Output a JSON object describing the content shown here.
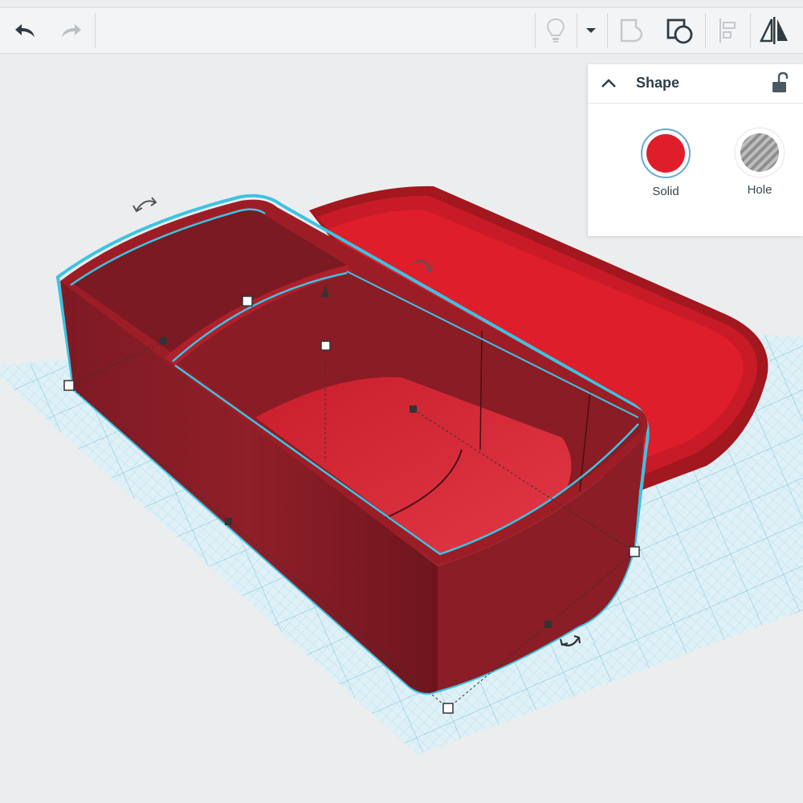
{
  "toolbar": {
    "buttons": [
      {
        "name": "undo-button",
        "icon": "undo-icon",
        "enabled": true
      },
      {
        "name": "redo-button",
        "icon": "redo-icon",
        "enabled": false
      },
      {
        "name": "notes-button",
        "icon": "lightbulb-icon",
        "enabled": false
      },
      {
        "name": "notes-dropdown-button",
        "icon": "caret-down-icon",
        "enabled": true
      },
      {
        "name": "group-button",
        "icon": "group-icon",
        "enabled": false
      },
      {
        "name": "ungroup-button",
        "icon": "ungroup-icon",
        "enabled": true
      },
      {
        "name": "align-button",
        "icon": "align-icon",
        "enabled": false
      },
      {
        "name": "mirror-button",
        "icon": "mirror-icon",
        "enabled": true
      }
    ]
  },
  "shape_panel": {
    "title": "Shape",
    "collapse_icon": "chevron-up-icon",
    "lock_icon": "unlock-icon",
    "options": [
      {
        "label": "Solid",
        "color": "#e01e2b",
        "selected": true
      },
      {
        "label": "Hole",
        "color": "#a6a6a6",
        "selected": false
      }
    ]
  },
  "workplane": {
    "grid_color": "#bfe3ef",
    "selection_outline_color": "#3cc3e3",
    "shape_color": "#8d1f28",
    "lid_color": "#d61d2a"
  }
}
